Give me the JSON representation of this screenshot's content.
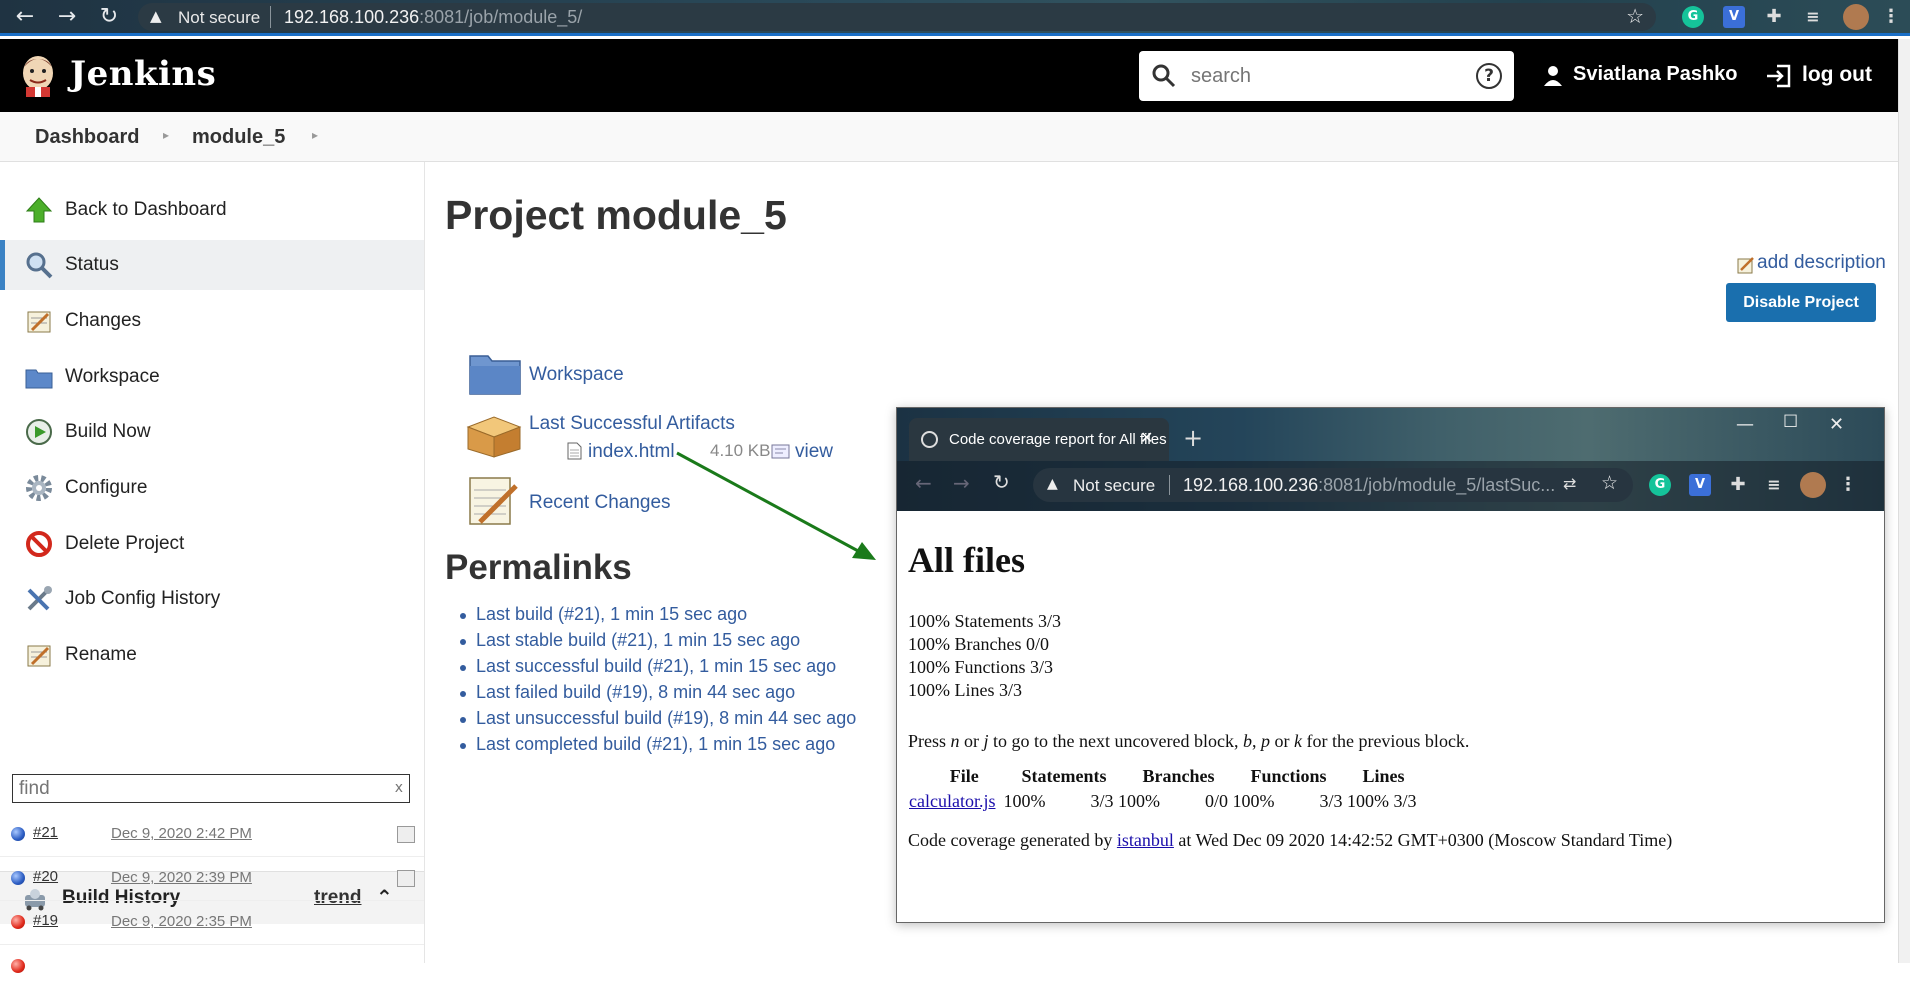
{
  "browser": {
    "security_label": "Not secure",
    "url_host": "192.168.100.236",
    "url_path": ":8081/job/module_5/"
  },
  "header": {
    "brand": "Jenkins",
    "search_placeholder": "search",
    "user_name": "Sviatlana Pashko",
    "logout_label": "log out"
  },
  "breadcrumb": [
    "Dashboard",
    "module_5"
  ],
  "sidebar": {
    "items": [
      {
        "label": "Back to Dashboard",
        "icon": "up-arrow-icon"
      },
      {
        "label": "Status",
        "icon": "magnifier-icon"
      },
      {
        "label": "Changes",
        "icon": "notepad-icon"
      },
      {
        "label": "Workspace",
        "icon": "folder-icon"
      },
      {
        "label": "Build Now",
        "icon": "clock-play-icon"
      },
      {
        "label": "Configure",
        "icon": "gear-icon"
      },
      {
        "label": "Delete Project",
        "icon": "no-entry-icon"
      },
      {
        "label": "Job Config History",
        "icon": "tools-icon"
      },
      {
        "label": "Rename",
        "icon": "notepad-icon"
      }
    ]
  },
  "build_history": {
    "title": "Build History",
    "trend": "trend",
    "find_placeholder": "find",
    "builds": [
      {
        "number": "#21",
        "date": "Dec 9, 2020 2:42 PM",
        "status": "success"
      },
      {
        "number": "#20",
        "date": "Dec 9, 2020 2:39 PM",
        "status": "success"
      },
      {
        "number": "#19",
        "date": "Dec 9, 2020 2:35 PM",
        "status": "failed"
      }
    ]
  },
  "main": {
    "title": "Project module_5",
    "add_description": "add description",
    "disable_button": "Disable Project",
    "workspace": "Workspace",
    "last_successful_artifacts": "Last Successful Artifacts",
    "artifact_file": "index.html",
    "artifact_size": "4.10 KB",
    "artifact_view": "view",
    "recent_changes": "Recent Changes",
    "permalinks_title": "Permalinks",
    "permalinks": [
      "Last build (#21), 1 min 15 sec ago",
      "Last stable build (#21), 1 min 15 sec ago",
      "Last successful build (#21), 1 min 15 sec ago",
      "Last failed build (#19), 8 min 44 sec ago",
      "Last unsuccessful build (#19), 8 min 44 sec ago",
      "Last completed build (#21), 1 min 15 sec ago"
    ]
  },
  "popup": {
    "tab_title": "Code coverage report for All files",
    "security_label": "Not secure",
    "url_host": "192.168.100.236",
    "url_path": ":8081/job/module_5/lastSuc...",
    "heading": "All files",
    "stats": [
      "100% Statements 3/3",
      "100% Branches 0/0",
      "100% Functions 3/3",
      "100% Lines 3/3"
    ],
    "hint": {
      "p1": "Press ",
      "n": "n",
      "p2": " or ",
      "j": "j",
      "p3": " to go to the next uncovered block, ",
      "b": "b",
      "p4": ", ",
      "p": "p",
      "p5": " or ",
      "k": "k",
      "p6": " for the previous block."
    },
    "table": {
      "headers": [
        "File",
        "Statements",
        "Branches",
        "Functions",
        "Lines"
      ],
      "row": {
        "file": "calculator.js",
        "stmt_pct": "100%",
        "stmt_frac": "3/3",
        "br_pct": "100%",
        "br_frac": "0/0",
        "fn_pct": "100%",
        "fn_frac": "3/3",
        "ln_pct": "100%",
        "ln_frac": "3/3"
      }
    },
    "footer_pre": "Code coverage generated by ",
    "footer_link": "istanbul",
    "footer_post": " at Wed Dec 09 2020 14:42:52 GMT+0300 (Moscow Standard Time)"
  },
  "colors": {
    "link": "#335c9e",
    "button": "#1a6fae",
    "arrow": "#1a7a1a"
  }
}
